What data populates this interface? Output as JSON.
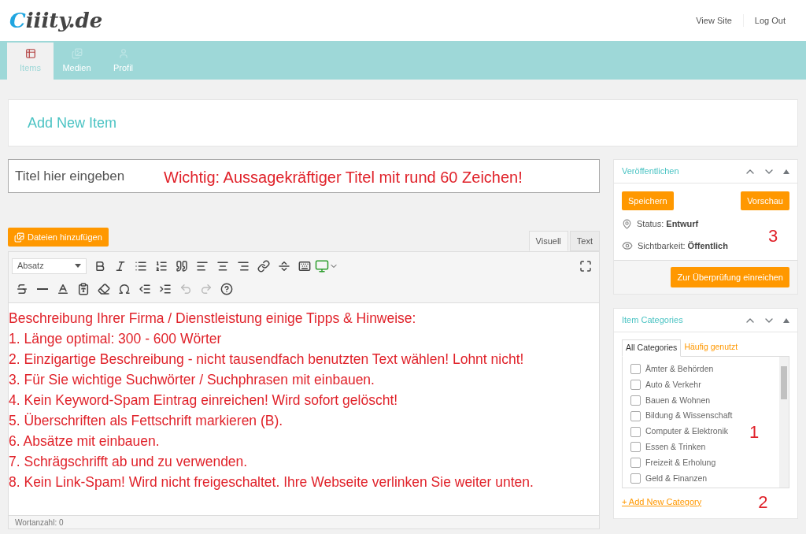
{
  "header": {
    "logo_first": "C",
    "logo_rest": "iiity.de",
    "links": [
      "View Site",
      "Log Out"
    ]
  },
  "nav_tabs": [
    {
      "label": "Items",
      "selected": true,
      "kind": "items"
    },
    {
      "label": "Medien",
      "selected": false,
      "kind": "media"
    },
    {
      "label": "Profil",
      "selected": false,
      "kind": "profile"
    }
  ],
  "page_title": "Add New Item",
  "title_field": {
    "placeholder": "Titel hier eingeben",
    "annotation": "Wichtig: Aussagekräftiger Titel mit rund 60 Zeichen!"
  },
  "media_button": "Dateien hinzufügen",
  "editor_tabs": [
    {
      "label": "Visuell",
      "selected": true
    },
    {
      "label": "Text",
      "selected": false
    }
  ],
  "format_select": "Absatz",
  "editor_lines": [
    "Beschreibung Ihrer Firma / Dienstleistung einige Tipps & Hinweise:",
    "1. Länge optimal: 300 - 600 Wörter",
    "2. Einzigartige Beschreibung - nicht tausendfach benutzten Text wählen! Lohnt nicht!",
    "3. Für Sie wichtige Suchwörter / Suchphrasen mit einbauen.",
    "4. Kein Keyword-Spam Eintrag einreichen! Wird sofort gelöscht!",
    "5. Überschriften als Fettschrift markieren (B).",
    "6. Absätze mit einbauen.",
    "7. Schrägschrifft ab und zu verwenden.",
    "8. Kein Link-Spam! Wird nicht freigeschaltet. Ihre Webseite verlinken Sie weiter unten."
  ],
  "word_count": "Wortanzahl: 0",
  "publish": {
    "title": "Veröffentlichen",
    "save": "Speichern",
    "preview": "Vorschau",
    "status_label": "Status:",
    "status_value": "Entwurf",
    "visibility_label": "Sichtbarkeit:",
    "visibility_value": "Öffentlich",
    "annotation": "3",
    "submit": "Zur Überprüfung einreichen"
  },
  "categories": {
    "title": "Item Categories",
    "tabs": [
      {
        "label": "All Categories",
        "selected": true
      },
      {
        "label": "Häufig genutzt",
        "selected": false
      }
    ],
    "items": [
      {
        "label": "Ämter & Behörden",
        "checked": false
      },
      {
        "label": "Auto & Verkehr",
        "checked": false
      },
      {
        "label": "Bauen & Wohnen",
        "checked": false
      },
      {
        "label": "Bildung & Wissenschaft",
        "checked": false
      },
      {
        "label": "Computer & Elektronik",
        "checked": false
      },
      {
        "label": "Essen & Trinken",
        "checked": false
      },
      {
        "label": "Freizeit & Erholung",
        "checked": false
      },
      {
        "label": "Geld & Finanzen",
        "checked": false
      }
    ],
    "annotation_list": "1",
    "add_link": "+ Add New Category",
    "annotation_link": "2"
  }
}
